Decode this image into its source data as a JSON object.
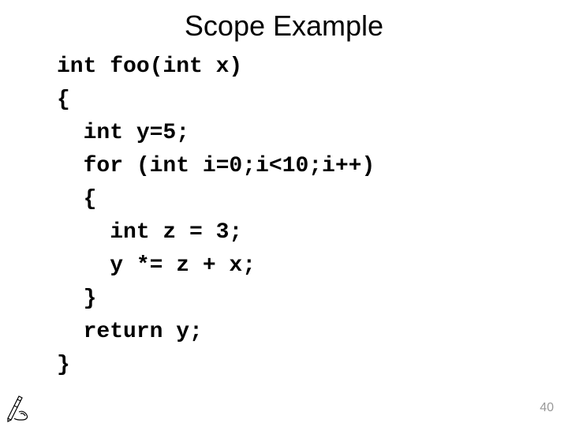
{
  "title": "Scope Example",
  "code": {
    "line1": "int foo(int x)",
    "line2": "{",
    "line3": "  int y=5;",
    "line4": "  for (int i=0;i<10;i++)",
    "line5": "  {",
    "line6": "    int z = 3;",
    "line7": "    y *= z + x;",
    "line8": "  }",
    "line9": "  return y;",
    "line10": "}"
  },
  "pageNumber": "40"
}
